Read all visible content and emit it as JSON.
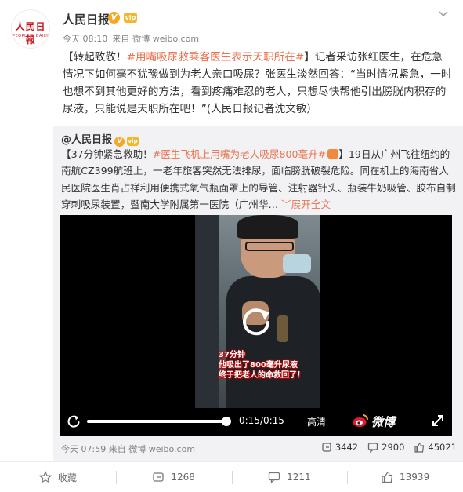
{
  "post": {
    "author": "人民日报",
    "logo_cn": "人民日報",
    "logo_en": "PEOPLE'S DAILY",
    "badge": "V",
    "vip": "vip",
    "time": "今天 08:10",
    "source_prefix": "来自",
    "source": "微博 weibo.com",
    "text": {
      "lead": "【转起致敬！",
      "tag": "#用嘴吸尿救乘客医生表示天职所在#",
      "body": "】记者采访张红医生，在危急情况下如何毫不犹豫做到为老人亲口吸尿？张医生淡然回答：“当时情况紧急，一时也想不到其他更好的方法，看到疼痛难忍的老人，只想尽快帮他引出膀胱内积存的尿液，只能说是天职所在吧！”(人民日报记者沈文敏）"
    }
  },
  "repost": {
    "author": "@人民日报",
    "text": {
      "lead": "【37分钟紧急救助！",
      "tag": "#医生飞机上用嘴为老人吸尿800毫升#",
      "body": "】19日从广州飞往纽约的南航CZ399航班上，一老年旅客突然无法排尿，面临膀胱破裂危险。同在机上的海南省人民医院医生肖占祥利用便携式氧气瓶面罩上的导管、注射器针头、瓶装牛奶吸管、胶布自制穿刺吸尿装置，暨南大学附属第一医院（广州华…",
      "expand": "展开全文",
      "expand_arrow": "﹀"
    },
    "video": {
      "overlay_lines": [
        "37分钟",
        "他吸出了800毫升尿液",
        "终于把老人的命救回了！"
      ],
      "time": "0:15/0:15",
      "progress": 1.0,
      "quality": "高清",
      "brand": "微博"
    },
    "time": "今天 07:59",
    "source_prefix": "来自",
    "source": "微博 weibo.com",
    "stats": {
      "reposts": "3442",
      "comments": "2900",
      "likes": "45021"
    }
  },
  "actions": {
    "favorite": "收藏",
    "repost": "1268",
    "comment": "1211",
    "like": "13939"
  },
  "colors": {
    "topic": "#eb7350",
    "brand_red": "#c8161d",
    "repost_bg": "#f2f2f5",
    "verified": "#f5a623"
  },
  "icons": [
    "chevron-down-icon",
    "replay-icon",
    "weibo-icon",
    "fullscreen-icon",
    "repost-icon",
    "comment-icon",
    "like-icon",
    "favorite-icon"
  ]
}
